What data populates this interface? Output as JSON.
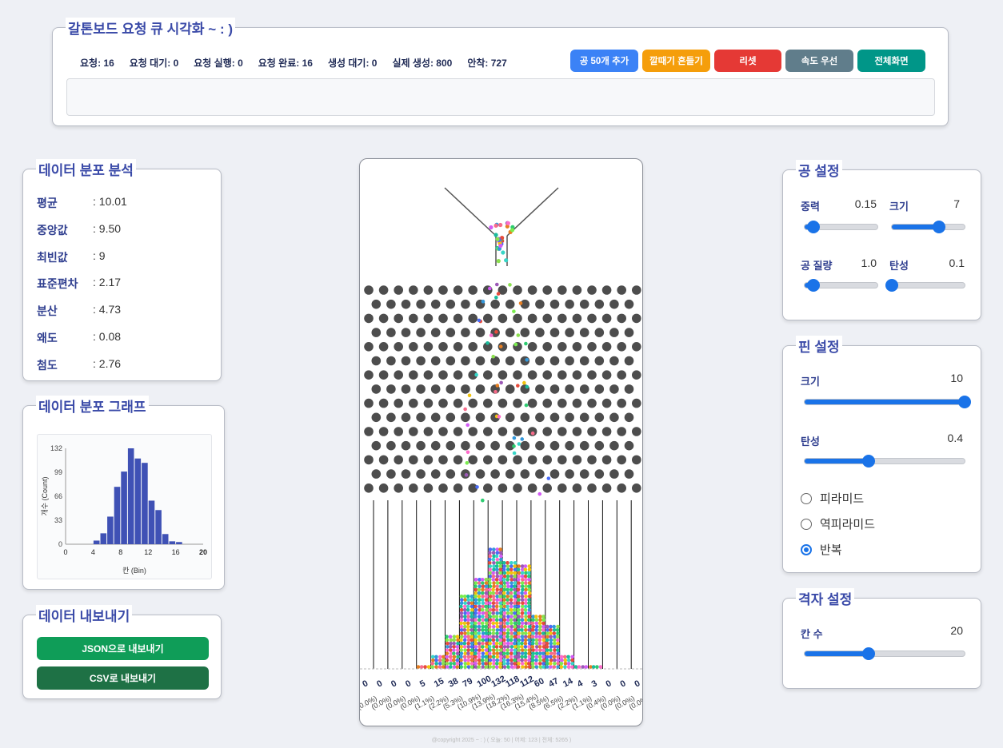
{
  "header": {
    "title": "갈톤보드 요청 큐 시각화 ~ : )",
    "stats": [
      "요청: 16",
      "요청 대기: 0",
      "요청 실행: 0",
      "요청 완료: 16",
      "생성 대기: 0",
      "실제 생성: 800",
      "안착: 727"
    ],
    "buttons": {
      "add": "공 50개 추가",
      "shake": "깔때기 흔들기",
      "reset": "리셋",
      "speed": "속도 우선",
      "fullscreen": "전체화면"
    },
    "colors": {
      "add": "#3b82f6",
      "shake": "#f59e0b",
      "reset": "#e53935",
      "speed": "#607d8b",
      "fullscreen": "#009688"
    }
  },
  "analysis": {
    "title": "데이터 분포 분석",
    "rows": [
      {
        "label": "평균",
        "value": ": 10.01"
      },
      {
        "label": "중앙값",
        "value": ": 9.50"
      },
      {
        "label": "최빈값",
        "value": ": 9"
      },
      {
        "label": "표준편차",
        "value": ": 2.17"
      },
      {
        "label": "분산",
        "value": ": 4.73"
      },
      {
        "label": "왜도",
        "value": ": 0.08"
      },
      {
        "label": "첨도",
        "value": ": 2.76"
      }
    ]
  },
  "graph": {
    "title": "데이터 분포 그래프"
  },
  "chart_data": {
    "type": "bar",
    "x": [
      0,
      1,
      2,
      3,
      4,
      5,
      6,
      7,
      8,
      9,
      10,
      11,
      12,
      13,
      14,
      15,
      16,
      17,
      18,
      19
    ],
    "values": [
      0,
      0,
      0,
      0,
      5,
      15,
      38,
      79,
      100,
      132,
      118,
      112,
      60,
      47,
      14,
      4,
      3,
      0,
      0,
      0
    ],
    "xlabel": "칸 (Bin)",
    "ylabel": "개수 (Count)",
    "yticks": [
      0,
      33,
      66,
      99,
      132
    ],
    "xticks": [
      0,
      4,
      8,
      12,
      16,
      20
    ],
    "xlim": [
      0,
      20
    ],
    "ylim": [
      0,
      132
    ],
    "color": "#3f51b5"
  },
  "export": {
    "title": "데이터 내보내기",
    "json": "JSON으로 내보내기",
    "csv": "CSV로 내보내기",
    "json_color": "#0f9d58",
    "csv_color": "#1e7145"
  },
  "board": {
    "counts": [
      0,
      0,
      0,
      0,
      5,
      15,
      38,
      79,
      100,
      132,
      118,
      112,
      60,
      47,
      14,
      4,
      3,
      0,
      0,
      0
    ],
    "percents": [
      "(0.0%)",
      "(0.0%)",
      "(0.0%)",
      "(0.0%)",
      "(1.1%)",
      "(2.2%)",
      "(5.3%)",
      "(10.9%)",
      "(13.9%)",
      "(18.2%)",
      "(16.3%)",
      "(15.4%)",
      "(8.5%)",
      "(6.5%)",
      "(2.2%)",
      "(1.1%)",
      "(0.4%)",
      "(0.0%)",
      "(0.0%)",
      "(0.0%)"
    ]
  },
  "ball_settings": {
    "title": "공 설정",
    "gravity": {
      "label": "중력",
      "value": "0.15",
      "fraction": 0.12
    },
    "size": {
      "label": "크기",
      "value": "7",
      "fraction": 0.65
    },
    "mass": {
      "label": "공 질량",
      "value": "1.0",
      "fraction": 0.12
    },
    "elasticity": {
      "label": "탄성",
      "value": "0.1",
      "fraction": 0.0
    }
  },
  "pin_settings": {
    "title": "핀 설정",
    "size": {
      "label": "크기",
      "value": "10",
      "fraction": 1.0
    },
    "elasticity": {
      "label": "탄성",
      "value": "0.4",
      "fraction": 0.4
    },
    "layouts": [
      "피라미드",
      "역피라미드",
      "반복"
    ],
    "selected_layout": 2
  },
  "grid_settings": {
    "title": "격자 설정",
    "bins": {
      "label": "칸 수",
      "value": "20",
      "fraction": 0.4
    }
  },
  "footer": {
    "text": "@copyright 2025 ~ : )    ( 오늘: 50 | 어제: 123 | 전체: 5265 )"
  }
}
